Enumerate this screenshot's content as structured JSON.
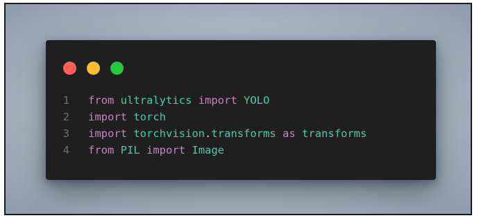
{
  "colors": {
    "dot_close": "#ff5f57",
    "dot_minimize": "#febc2e",
    "dot_maximize": "#28c840",
    "keyword": "#c586c0",
    "module": "#4ec9b0",
    "line_number": "#6e6e6e"
  },
  "window_controls": {
    "close": "close-dot",
    "minimize": "minimize-dot",
    "maximize": "maximize-dot"
  },
  "code": {
    "lines": [
      {
        "number": "1",
        "t1": "from",
        "t2": "ultralytics",
        "t3": "import",
        "t4": "YOLO"
      },
      {
        "number": "2",
        "t1": "import",
        "t2": "torch"
      },
      {
        "number": "3",
        "t1": "import",
        "t2": "torchvision",
        "t3": ".",
        "t4": "transforms",
        "t5": "as",
        "t6": "transforms"
      },
      {
        "number": "4",
        "t1": "from",
        "t2": "PIL",
        "t3": "import",
        "t4": "Image"
      }
    ]
  }
}
